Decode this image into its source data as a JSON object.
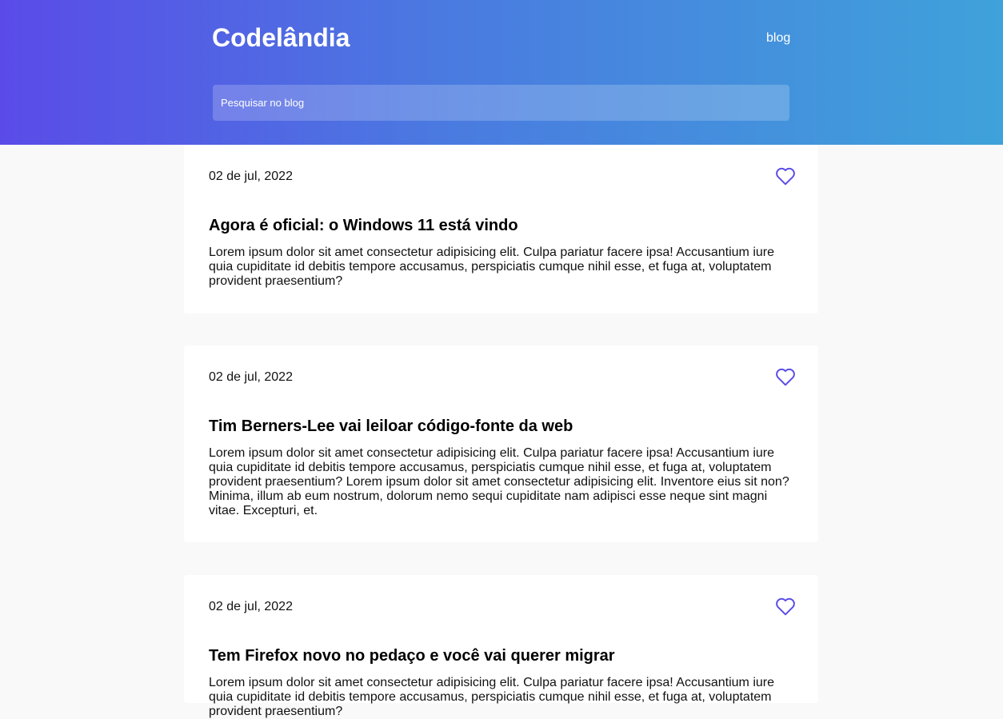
{
  "header": {
    "brand": "Codelândia",
    "nav_link": "blog",
    "search_placeholder": "Pesquisar no blog"
  },
  "colors": {
    "gradient_start": "#5a4be8",
    "gradient_end": "#3fa2da",
    "heart": "#5a4be8",
    "background": "#f9f9f9"
  },
  "posts": [
    {
      "date": "02 de jul, 2022",
      "title": "Agora é oficial: o Windows 11 está vindo",
      "body": "Lorem ipsum dolor sit amet consectetur adipisicing elit. Culpa pariatur facere ipsa! Accusantium iure quia cupiditate id debitis tempore accusamus, perspiciatis cumque nihil esse, et fuga at, voluptatem provident praesentium?",
      "icon": "heart-outline-icon"
    },
    {
      "date": "02 de jul, 2022",
      "title": "Tim Berners-Lee vai leiloar código-fonte da web",
      "body": "Lorem ipsum dolor sit amet consectetur adipisicing elit. Culpa pariatur facere ipsa! Accusantium iure quia cupiditate id debitis tempore accusamus, perspiciatis cumque nihil esse, et fuga at, voluptatem provident praesentium? Lorem ipsum dolor sit amet consectetur adipisicing elit. Inventore eius sit non? Minima, illum ab eum nostrum, dolorum nemo sequi cupiditate nam adipisci esse neque sint magni vitae. Excepturi, et.",
      "icon": "heart-outline-icon"
    },
    {
      "date": "02 de jul, 2022",
      "title": "Tem Firefox novo no pedaço e você vai querer migrar",
      "body": "Lorem ipsum dolor sit amet consectetur adipisicing elit. Culpa pariatur facere ipsa! Accusantium iure quia cupiditate id debitis tempore accusamus, perspiciatis cumque nihil esse, et fuga at, voluptatem provident praesentium?",
      "icon": "heart-outline-icon"
    }
  ]
}
